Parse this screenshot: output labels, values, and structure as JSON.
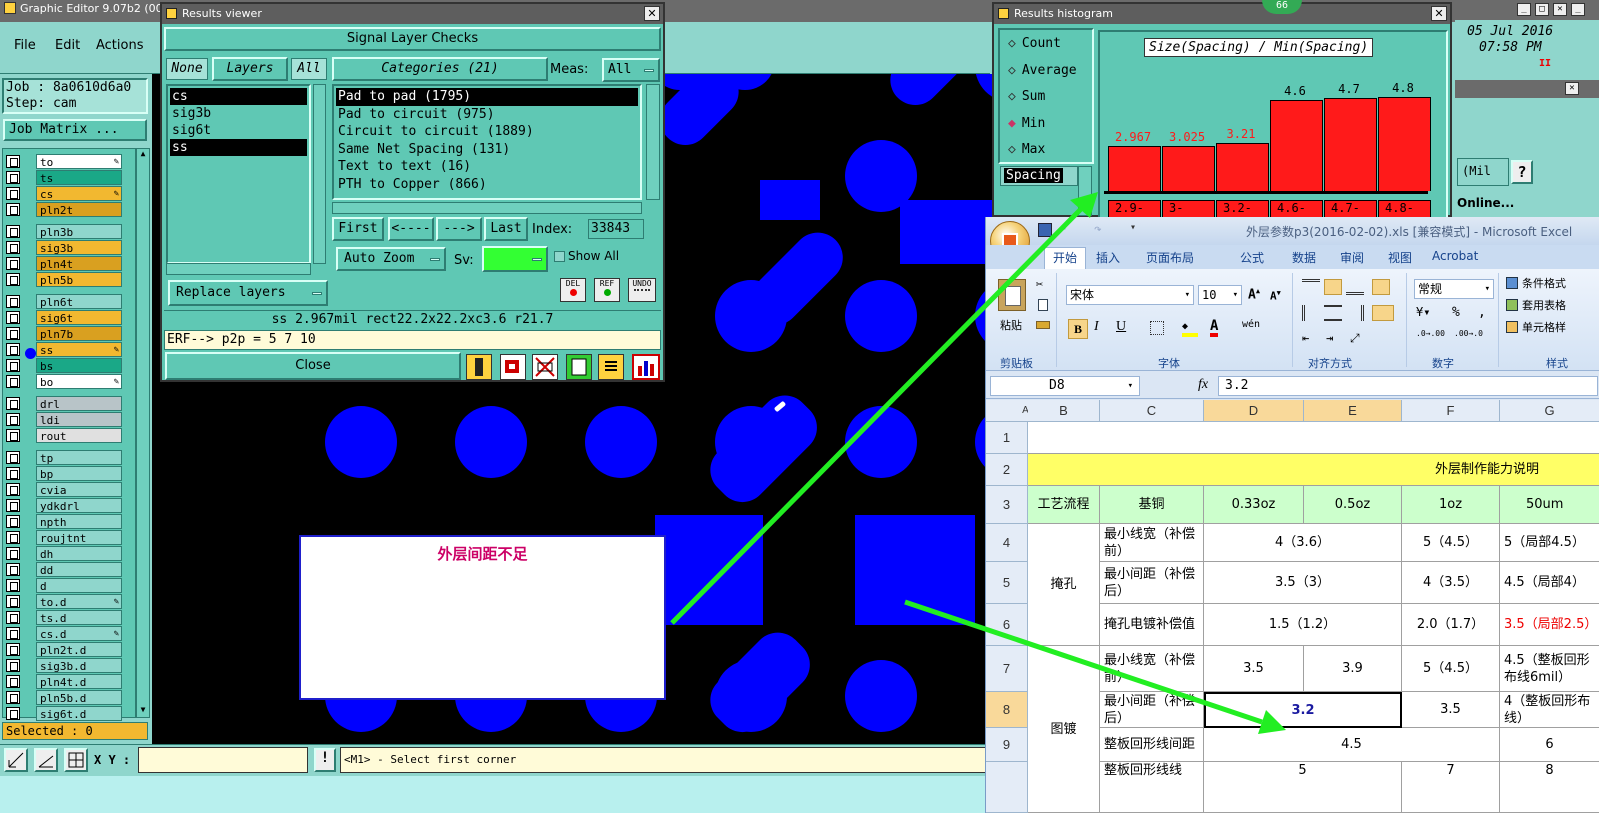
{
  "main_window": {
    "title": "Graphic Editor 9.07b2 (00",
    "menu": [
      "File",
      "Edit",
      "Actions"
    ],
    "job": "Job : 8a0610d6a0",
    "step": "Step: cam",
    "job_matrix": "Job Matrix ...",
    "selected": "Selected : 0",
    "xy_label": "X Y :",
    "prompt": "<M1> - Select first corner",
    "warn_glyph": "!"
  },
  "layers": [
    {
      "name": "to",
      "color": "#ffffff",
      "mark": "✎"
    },
    {
      "name": "ts",
      "color": "#1aa887"
    },
    {
      "name": "cs",
      "color": "#f2b830",
      "mark": "✎"
    },
    {
      "name": "pln2t",
      "color": "#d9a020"
    },
    {
      "name": "pln3b",
      "color": "#8fd6cc"
    },
    {
      "name": "sig3b",
      "color": "#f2b830"
    },
    {
      "name": "pln4t",
      "color": "#d9a020"
    },
    {
      "name": "pln5b",
      "color": "#f2b830"
    },
    {
      "name": "pln6t",
      "color": "#8fd6cc"
    },
    {
      "name": "sig6t",
      "color": "#f2b830"
    },
    {
      "name": "pln7b",
      "color": "#d9a020"
    },
    {
      "name": "ss",
      "color": "#f2b830",
      "mark": "✎"
    },
    {
      "name": "bs",
      "color": "#1aa887"
    },
    {
      "name": "bo",
      "color": "#ffffff",
      "mark": "✎"
    },
    {
      "name": "drl",
      "color": "#b8c4c8"
    },
    {
      "name": "ldi",
      "color": "#b8c4c8"
    },
    {
      "name": "rout",
      "color": "#e0e0e0"
    },
    {
      "name": "tp",
      "color": "#8fd6cc"
    },
    {
      "name": "bp",
      "color": "#8fd6cc"
    },
    {
      "name": "cvia",
      "color": "#8fd6cc"
    },
    {
      "name": "ydkdrl",
      "color": "#8fd6cc"
    },
    {
      "name": "npth",
      "color": "#8fd6cc"
    },
    {
      "name": "roujtnt",
      "color": "#8fd6cc"
    },
    {
      "name": "dh",
      "color": "#8fd6cc"
    },
    {
      "name": "dd",
      "color": "#8fd6cc"
    },
    {
      "name": "d",
      "color": "#8fd6cc"
    },
    {
      "name": "to.d",
      "color": "#8fd6cc",
      "mark": "✎"
    },
    {
      "name": "ts.d",
      "color": "#8fd6cc"
    },
    {
      "name": "cs.d",
      "color": "#8fd6cc",
      "mark": "✎"
    },
    {
      "name": "pln2t.d",
      "color": "#8fd6cc"
    },
    {
      "name": "sig3b.d",
      "color": "#8fd6cc"
    },
    {
      "name": "pln4t.d",
      "color": "#8fd6cc"
    },
    {
      "name": "pln5b.d",
      "color": "#8fd6cc"
    },
    {
      "name": "sig6t.d",
      "color": "#8fd6cc"
    }
  ],
  "results_viewer": {
    "title": "Results viewer",
    "heading": "Signal Layer Checks",
    "btn_none": "None",
    "layers_label": "Layers",
    "btn_all": "All",
    "categories_label": "Categories (21)",
    "meas_label": "Meas:",
    "meas_value": "All",
    "layer_list": [
      "cs",
      "sig3b",
      "sig6t",
      "ss"
    ],
    "categories": [
      "Pad to pad (1795)",
      "Pad to circuit (975)",
      "Circuit to circuit (1889)",
      "Same Net Spacing (131)",
      "Text to text (16)",
      "PTH to Copper (866)"
    ],
    "nav": {
      "first": "First",
      "prev": "<----",
      "next": "--->",
      "last": "Last",
      "index_label": "Index:",
      "index_value": "33843"
    },
    "auto_zoom": "Auto Zoom",
    "sv_label": "Sv:",
    "show_all": "Show All",
    "replace_layers": "Replace layers",
    "icons": {
      "del": "DEL",
      "ref": "REF",
      "undo": "UNDO"
    },
    "status": "ss 2.967mil   rect22.2x22.2xc3.6   r21.7",
    "erf": "ERF--> p2p = 5 7 10",
    "close": "Close"
  },
  "histogram": {
    "title": "Results histogram",
    "badge": "66",
    "options": [
      "Count",
      "Average",
      "Sum",
      "Min",
      "Max"
    ],
    "selected": "Min",
    "field": "Spacing",
    "chart_title": "Size(Spacing) / Min(Spacing)",
    "bins": [
      "2.9-",
      "3-",
      "3.2-",
      "4.6-",
      "4.7-",
      "4.8-"
    ]
  },
  "chart_data": {
    "type": "bar",
    "title": "Size(Spacing) / Min(Spacing)",
    "categories": [
      "2.9-",
      "3-",
      "3.2-",
      "4.6-",
      "4.7-",
      "4.8-"
    ],
    "values": [
      2.967,
      3.025,
      3.21,
      4.6,
      4.7,
      4.8
    ],
    "value_labels": [
      "2.967",
      "3.025",
      "3.21",
      "4.6",
      "4.7",
      "4.8"
    ],
    "ylim": [
      0,
      5.2
    ],
    "bar_color": "#ff1a1a"
  },
  "clock": {
    "date": "05 Jul 2016",
    "time": "07:58 PM"
  },
  "side_panel": {
    "units": "(Mil",
    "help": "?",
    "online": "Online..."
  },
  "annotation": {
    "text": "外层间距不足"
  },
  "excel": {
    "title": "外层参数p3(2016-02-02).xls  [兼容模式] - Microsoft Excel",
    "tabs": [
      "开始",
      "插入",
      "页面布局",
      "公式",
      "数据",
      "审阅",
      "视图",
      "Acrobat"
    ],
    "font_name": "宋体",
    "font_size": "10",
    "number_format": "常规",
    "paste": "粘贴",
    "groups": [
      "剪贴板",
      "字体",
      "对齐方式",
      "数字",
      "样式"
    ],
    "styles": [
      "条件格式",
      "套用表格",
      "单元格样"
    ],
    "cell_ref": "D8",
    "fx": "fx",
    "formula_value": "3.2",
    "columns": [
      "A",
      "B",
      "C",
      "D",
      "E",
      "F",
      "G"
    ],
    "rows": [
      "1",
      "2",
      "3",
      "4",
      "5",
      "6",
      "7",
      "8",
      "9"
    ],
    "sheet": {
      "title": "外层制作能力说明",
      "h_process": "工艺流程",
      "h_base": "基铜",
      "h_033": "0.33oz",
      "h_05": "0.5oz",
      "h_1": "1oz",
      "h_50": "50um",
      "g1": "掩孔",
      "g2": "图镀",
      "r4": [
        "最小线宽（补偿前）",
        "4（3.6）",
        "5（4.5）",
        "5（局部4.5）"
      ],
      "r5": [
        "最小间距（补偿后）",
        "3.5（3）",
        "4（3.5）",
        "4.5（局部4）"
      ],
      "r6": [
        "掩孔电镀补偿值",
        "1.5（1.2）",
        "2.0（1.7）",
        "3.5（局部2.5）"
      ],
      "r7": [
        "最小线宽（补偿前）",
        "3.5",
        "3.9",
        "5（4.5）",
        "4.5（整板回形布线6mil）"
      ],
      "r8": [
        "最小间距（补偿后）",
        "3.2",
        "3.5",
        "4（整板回形布线）"
      ],
      "r9": [
        "整板回形线间距",
        "4.5",
        "6"
      ],
      "r10": [
        "整板回形线线",
        "5",
        "7",
        "8"
      ]
    }
  }
}
